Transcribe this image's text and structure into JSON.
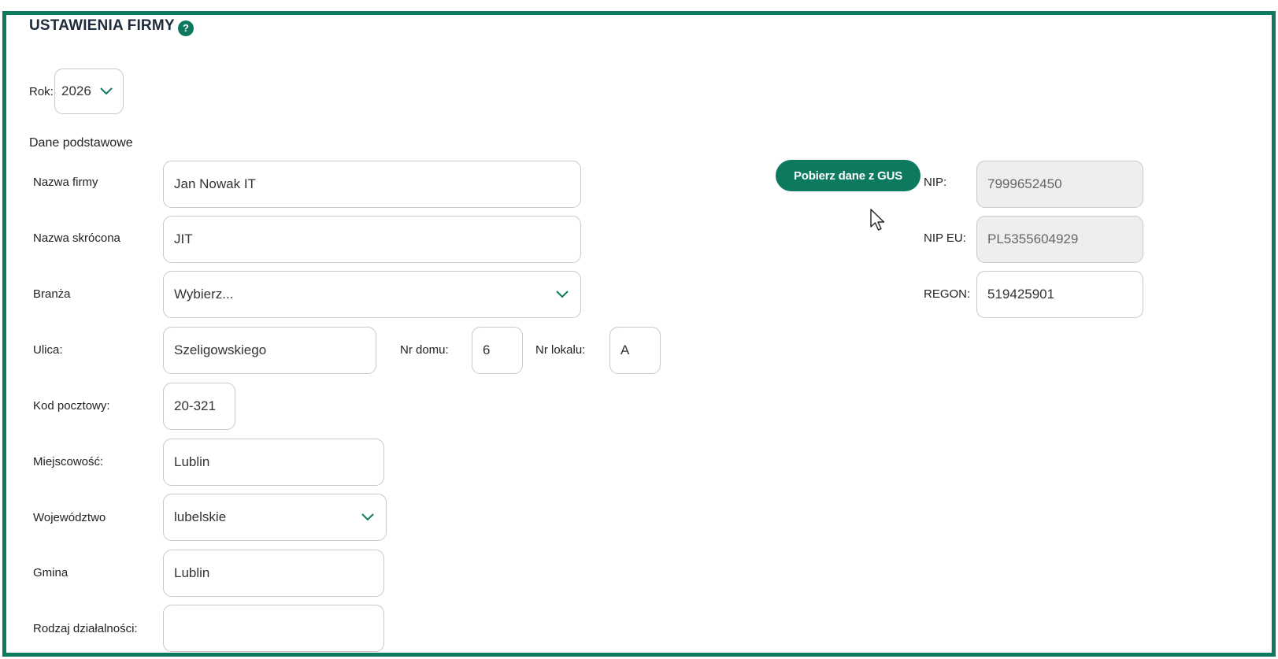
{
  "header": {
    "title": "USTAWIENIA FIRMY",
    "help_icon": "question-circle-icon",
    "help_glyph": "?"
  },
  "year": {
    "label": "Rok:",
    "value": "2026"
  },
  "section": {
    "title": "Dane podstawowe"
  },
  "company": {
    "name": {
      "label": "Nazwa firmy",
      "value": "Jan Nowak IT"
    },
    "short_name": {
      "label": "Nazwa skrócona",
      "value": "JIT"
    },
    "industry": {
      "label": "Branża",
      "value": "Wybierz..."
    },
    "street": {
      "label": "Ulica:",
      "value": "Szeligowskiego"
    },
    "house_no": {
      "label": "Nr domu:",
      "value": "6"
    },
    "apartment_no": {
      "label": "Nr lokalu:",
      "value": "A"
    },
    "postal_code": {
      "label": "Kod pocztowy:",
      "value": "20-321"
    },
    "city": {
      "label": "Miejscowość:",
      "value": "Lublin"
    },
    "voivodeship": {
      "label": "Województwo",
      "value": "lubelskie"
    },
    "commune": {
      "label": "Gmina",
      "value": "Lublin"
    },
    "activity_type": {
      "label": "Rodzaj działalności:",
      "value": ""
    }
  },
  "tax": {
    "gus_button": "Pobierz dane z GUS",
    "nip": {
      "label": "NIP:",
      "value": "7999652450"
    },
    "nip_eu": {
      "label": "NIP EU:",
      "value": "PL5355604929"
    },
    "regon": {
      "label": "REGON:",
      "value": "519425901"
    }
  },
  "colors": {
    "accent": "#0d7a5f",
    "border": "#c9c9c9",
    "disabled_bg": "#eeeeee"
  }
}
